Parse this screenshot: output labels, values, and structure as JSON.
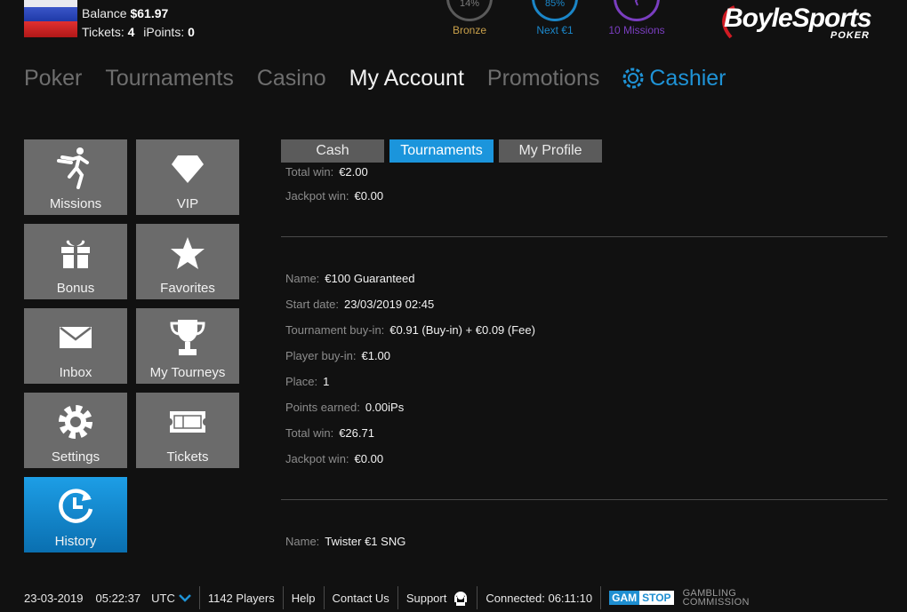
{
  "account": {
    "balance_label": "Balance",
    "balance_value": "$61.97",
    "tickets_label": "Tickets:",
    "tickets_value": "4",
    "ipoints_label": "iPoints:",
    "ipoints_value": "0"
  },
  "progress": [
    {
      "ring_text": "14%",
      "label": "Bronze",
      "color": "#c9a04a"
    },
    {
      "ring_text": "85%",
      "label": "Next €1",
      "color": "#1b86c8"
    },
    {
      "ring_text": "",
      "label": "10 Missions",
      "color": "#7a3ec0"
    }
  ],
  "logo": {
    "main": "BoyleSports",
    "sub": "POKER"
  },
  "nav": {
    "poker": "Poker",
    "tournaments": "Tournaments",
    "casino": "Casino",
    "my_account": "My Account",
    "promotions": "Promotions",
    "cashier": "Cashier",
    "active": "My Account"
  },
  "tiles": [
    {
      "label": "Missions",
      "icon": "missions-icon"
    },
    {
      "label": "VIP",
      "icon": "diamond-icon"
    },
    {
      "label": "Bonus",
      "icon": "gift-icon"
    },
    {
      "label": "Favorites",
      "icon": "star-icon"
    },
    {
      "label": "Inbox",
      "icon": "envelope-icon"
    },
    {
      "label": "My Tourneys",
      "icon": "trophy-icon"
    },
    {
      "label": "Settings",
      "icon": "gear-icon"
    },
    {
      "label": "Tickets",
      "icon": "ticket-icon"
    },
    {
      "label": "History",
      "icon": "history-icon",
      "active": true
    }
  ],
  "tabs": {
    "cash": "Cash",
    "tournaments": "Tournaments",
    "my_profile": "My Profile",
    "active": "Tournaments"
  },
  "history": {
    "partial_top": {
      "total_win_label": "Total win:",
      "total_win_value": "€2.00",
      "jackpot_label": "Jackpot win:",
      "jackpot_value": "€0.00"
    },
    "entry": {
      "name_label": "Name:",
      "name_value": "€100 Guaranteed",
      "start_label": "Start date:",
      "start_value": "23/03/2019 02:45",
      "buyin_label": "Tournament buy-in:",
      "buyin_value": "€0.91 (Buy-in) + €0.09 (Fee)",
      "player_buyin_label": "Player buy-in:",
      "player_buyin_value": "€1.00",
      "place_label": "Place:",
      "place_value": "1",
      "points_label": "Points earned:",
      "points_value": "0.00iPs",
      "total_win_label": "Total win:",
      "total_win_value": "€26.71",
      "jackpot_label": "Jackpot win:",
      "jackpot_value": "€0.00"
    },
    "partial_bottom": {
      "name_label": "Name:",
      "name_value": "Twister €1 SNG"
    }
  },
  "footer": {
    "date": "23-03-2019",
    "time": "05:22:37",
    "timezone": "UTC",
    "players": "1142 Players",
    "help": "Help",
    "contact": "Contact Us",
    "support": "Support",
    "connected": "Connected: 06:11:10",
    "gamstop_gam": "GAM",
    "gamstop_stop": "STOP",
    "gambling": "GAMBLING",
    "commission": "COMMISSION"
  },
  "colors": {
    "accent": "#1b95dc",
    "background": "#111111",
    "tile": "#6b6b6b"
  }
}
